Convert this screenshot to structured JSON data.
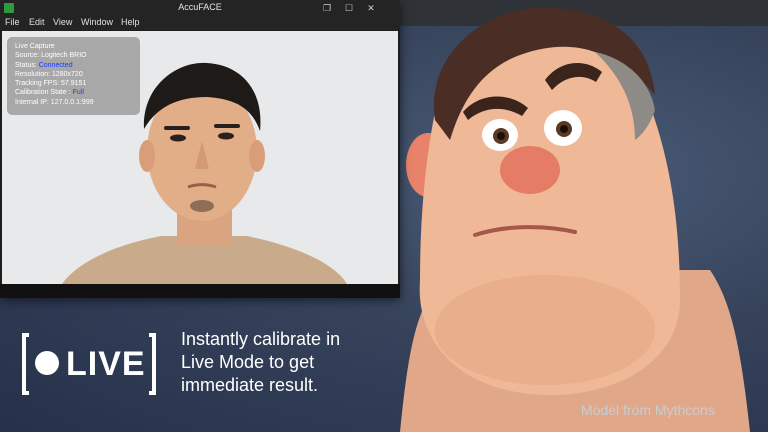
{
  "app": {
    "title": "AccuFACE",
    "menu": [
      "File",
      "Edit",
      "View",
      "Window",
      "Help"
    ]
  },
  "overlay": {
    "lines": [
      {
        "label": "Live Capture",
        "value": ""
      },
      {
        "label": "Source: ",
        "value": "Logitech BRIO"
      },
      {
        "label": "Status: ",
        "value": "Connected"
      },
      {
        "label": "Resolution: ",
        "value": "1280x720"
      },
      {
        "label": "Tracking FPS: ",
        "value": "57.9151"
      },
      {
        "label": "Calibration State : ",
        "value": "Full"
      },
      {
        "label": "Internal IP: ",
        "value": "127.0.0.1:999"
      }
    ]
  },
  "promo": {
    "live_label": "LIVE",
    "caption": [
      "Instantly calibrate in",
      "Live Mode to get",
      "immediate result."
    ],
    "credit": "Model from Mythcons"
  },
  "colors": {
    "status_connected": "#1a3cff",
    "background": "#36435b",
    "app_icon": "#2a9a3a"
  }
}
